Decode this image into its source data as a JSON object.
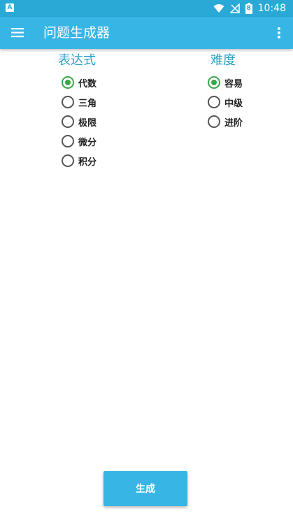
{
  "status_bar": {
    "notification_icon": "A",
    "battery_level": "8",
    "time": "10:48",
    "icons": [
      "wifi-icon",
      "no-signal-icon",
      "battery-icon"
    ]
  },
  "app_bar": {
    "title": "问题生成器",
    "menu_icon": "menu-icon",
    "more_icon": "more-vert-icon"
  },
  "expression": {
    "title": "表达式",
    "options": [
      {
        "label": "代数",
        "checked": true
      },
      {
        "label": "三角",
        "checked": false
      },
      {
        "label": "极限",
        "checked": false
      },
      {
        "label": "微分",
        "checked": false
      },
      {
        "label": "积分",
        "checked": false
      }
    ]
  },
  "difficulty": {
    "title": "难度",
    "options": [
      {
        "label": "容易",
        "checked": true
      },
      {
        "label": "中级",
        "checked": false
      },
      {
        "label": "进阶",
        "checked": false
      }
    ]
  },
  "generate_button": {
    "label": "生成"
  },
  "colors": {
    "primary": "#37b6e6",
    "status_bar": "#2aa9d6",
    "section_title": "#2a9fc6",
    "radio_checked": "#3aa648"
  }
}
